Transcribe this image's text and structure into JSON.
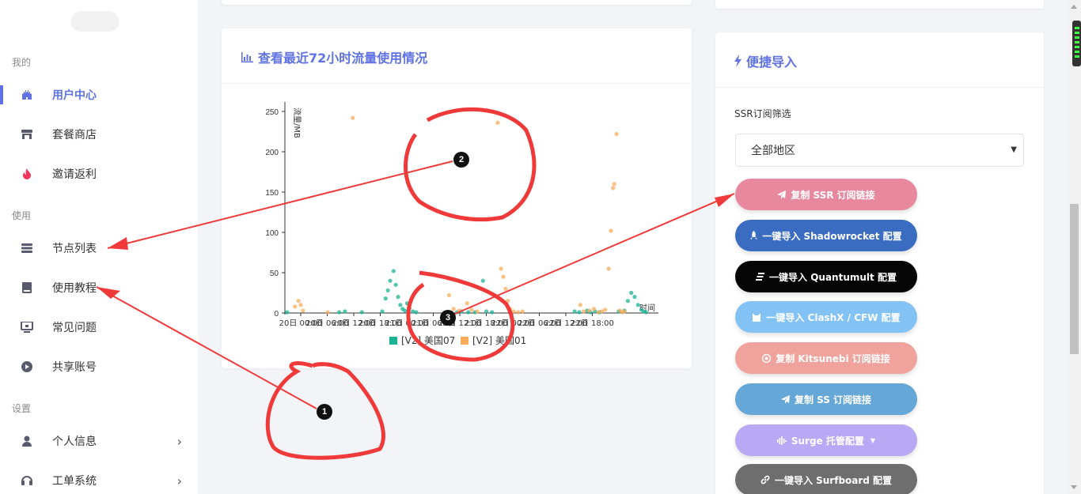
{
  "sidebar": {
    "sections": [
      {
        "label": "我的"
      },
      {
        "label": "使用"
      },
      {
        "label": "设置"
      }
    ],
    "items": [
      {
        "label": "用户中心",
        "icon": "castle-icon"
      },
      {
        "label": "套餐商店",
        "icon": "store-icon"
      },
      {
        "label": "邀请返利",
        "icon": "fire-icon"
      },
      {
        "label": "节点列表",
        "icon": "server-icon"
      },
      {
        "label": "使用教程",
        "icon": "book-icon"
      },
      {
        "label": "常见问题",
        "icon": "monitor-icon"
      },
      {
        "label": "共享账号",
        "icon": "play-icon"
      },
      {
        "label": "个人信息",
        "icon": "user-icon"
      },
      {
        "label": "工单系统",
        "icon": "headset-icon"
      }
    ]
  },
  "traffic_card": {
    "title": "查看最近72小时流量使用情况"
  },
  "chart_data": {
    "type": "scatter",
    "ylabel": "流量/MB",
    "xlabel": "时间",
    "ylim": [
      0,
      250
    ],
    "yticks": [
      "250",
      "200",
      "150",
      "100",
      "50",
      "0"
    ],
    "xticks": [
      "20日 00:00",
      "20日 06:00",
      "20日 12:00",
      "20日 18:00",
      "21日 00:00",
      "21日 06:00",
      "21日 12:00",
      "21日 18:00",
      "22日 00:00",
      "22日 06:00",
      "22日 12:00",
      "22日 18:00"
    ],
    "series": [
      {
        "name": "[V2] 美国07",
        "color": "#1ab394",
        "points": [
          [
            0.2,
            1
          ],
          [
            4.8,
            1
          ],
          [
            5.3,
            2
          ],
          [
            6.8,
            1
          ],
          [
            8.6,
            2
          ],
          [
            8.9,
            18
          ],
          [
            9.1,
            28
          ],
          [
            9.3,
            40
          ],
          [
            9.6,
            52
          ],
          [
            9.8,
            35
          ],
          [
            10.0,
            20
          ],
          [
            10.2,
            10
          ],
          [
            10.4,
            5
          ],
          [
            10.6,
            3
          ],
          [
            10.8,
            12
          ],
          [
            11.0,
            6
          ],
          [
            11.3,
            2
          ],
          [
            11.6,
            1
          ],
          [
            15.2,
            1
          ],
          [
            15.6,
            2
          ],
          [
            16.2,
            1
          ],
          [
            16.8,
            1
          ],
          [
            17.5,
            40
          ],
          [
            17.8,
            2
          ],
          [
            18.3,
            1
          ],
          [
            25.6,
            2
          ],
          [
            26.0,
            1
          ],
          [
            26.7,
            3
          ],
          [
            27.0,
            1
          ],
          [
            27.4,
            2
          ],
          [
            27.8,
            1
          ],
          [
            29.5,
            2
          ],
          [
            30.0,
            3
          ],
          [
            30.3,
            15
          ],
          [
            30.6,
            25
          ],
          [
            30.9,
            20
          ],
          [
            31.2,
            10
          ],
          [
            31.5,
            4
          ],
          [
            31.7,
            2
          ],
          [
            31.9,
            1
          ]
        ]
      },
      {
        "name": "[V2] 美国01",
        "color": "#f8ac59",
        "points": [
          [
            0.9,
            8
          ],
          [
            1.2,
            15
          ],
          [
            1.4,
            10
          ],
          [
            1.6,
            3
          ],
          [
            3.8,
            1
          ],
          [
            6.0,
            242
          ],
          [
            14.5,
            22
          ],
          [
            14.9,
            5
          ],
          [
            15.4,
            3
          ],
          [
            16.1,
            12
          ],
          [
            16.5,
            4
          ],
          [
            17.0,
            2
          ],
          [
            18.8,
            236
          ],
          [
            19.1,
            55
          ],
          [
            19.3,
            45
          ],
          [
            19.5,
            30
          ],
          [
            19.7,
            15
          ],
          [
            19.9,
            5
          ],
          [
            20.2,
            2
          ],
          [
            20.6,
            1
          ],
          [
            21.0,
            2
          ],
          [
            26.1,
            10
          ],
          [
            26.4,
            2
          ],
          [
            26.9,
            3
          ],
          [
            27.3,
            5
          ],
          [
            27.7,
            1
          ],
          [
            28.0,
            2
          ],
          [
            28.3,
            4
          ],
          [
            28.6,
            55
          ],
          [
            28.8,
            102
          ],
          [
            29.0,
            155
          ],
          [
            29.1,
            160
          ],
          [
            29.3,
            222
          ],
          [
            29.6,
            3
          ],
          [
            29.8,
            1
          ],
          [
            30.0,
            2
          ]
        ]
      }
    ],
    "legend_position": "bottom"
  },
  "import_card": {
    "title": "便捷导入",
    "filter_label": "SSR订阅筛选",
    "filter_value": "全部地区",
    "buttons": [
      {
        "label": "复制 SSR 订阅链接",
        "color": "#e8889f",
        "icon": "paper-plane-icon"
      },
      {
        "label": "一键导入 Shadowrocket 配置",
        "color": "#3a6cc2",
        "icon": "rocket-icon"
      },
      {
        "label": "一键导入 Quantumult 配置",
        "color": "#050505",
        "icon": "quantumult-icon"
      },
      {
        "label": "一键导入 ClashX / CFW 配置",
        "color": "#83c2f5",
        "icon": "cat-icon"
      },
      {
        "label": "复制 Kitsunebi 订阅链接",
        "color": "#f0a39c",
        "icon": "kitsunebi-icon"
      },
      {
        "label": "复制 SS 订阅链接",
        "color": "#65a7d6",
        "icon": "paper-plane-icon"
      },
      {
        "label": "Surge 托管配置",
        "color": "#b8a9f5",
        "icon": "waveform-icon"
      },
      {
        "label": "一键导入 Surfboard 配置",
        "color": "#6e6e6e",
        "icon": "link-icon"
      }
    ]
  },
  "annotations": {
    "markers": [
      "1",
      "2",
      "3"
    ]
  }
}
